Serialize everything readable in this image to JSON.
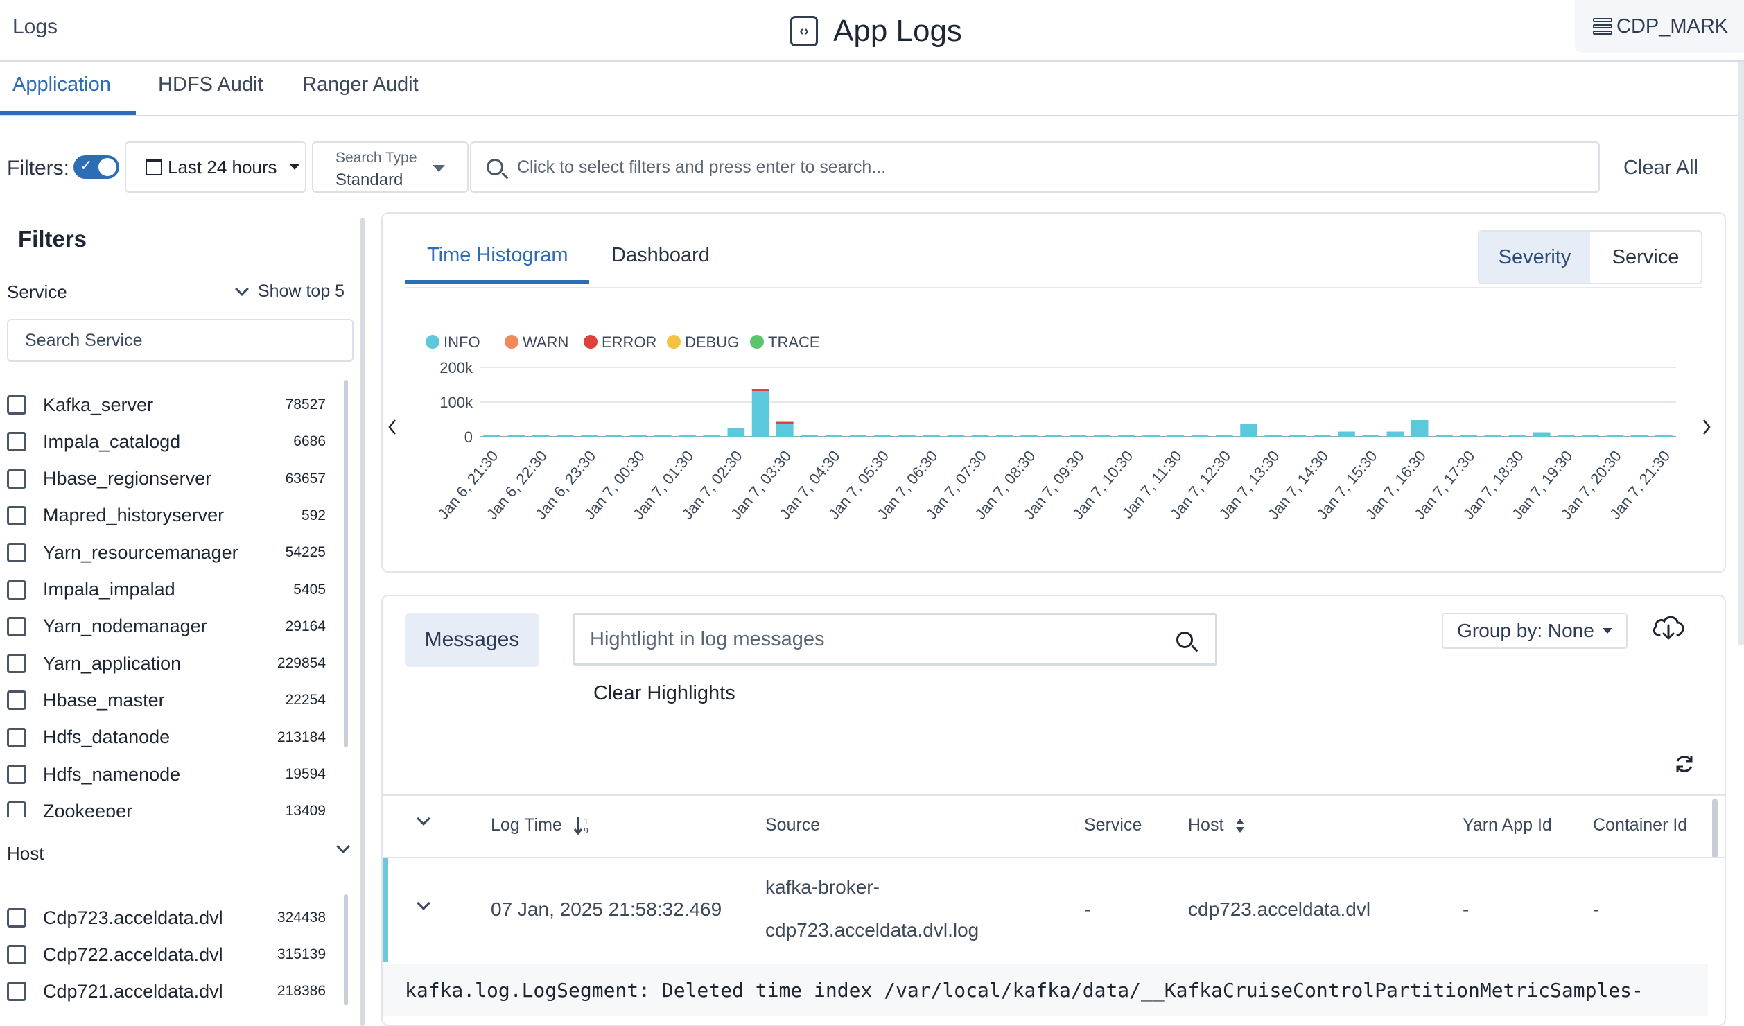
{
  "header": {
    "breadcrumb": "Logs",
    "title": "App Logs",
    "cluster": "CDP_MARK"
  },
  "tabs": [
    {
      "label": "Application",
      "active": true
    },
    {
      "label": "HDFS Audit",
      "active": false
    },
    {
      "label": "Ranger Audit",
      "active": false
    }
  ],
  "filterbar": {
    "label": "Filters:",
    "toggle_on": true,
    "date_range": "Last 24 hours",
    "search_type_label": "Search Type",
    "search_type_value": "Standard",
    "search_placeholder": "Click to select filters and press enter to search...",
    "clear_all": "Clear All"
  },
  "left_filters": {
    "title": "Filters",
    "service_heading": "Service",
    "show_top": "Show top 5",
    "search_placeholder": "Search Service",
    "services": [
      {
        "name": "Kafka_server",
        "count": "78527"
      },
      {
        "name": "Impala_catalogd",
        "count": "6686"
      },
      {
        "name": "Hbase_regionserver",
        "count": "63657"
      },
      {
        "name": "Mapred_historyserver",
        "count": "592"
      },
      {
        "name": "Yarn_resourcemanager",
        "count": "54225"
      },
      {
        "name": "Impala_impalad",
        "count": "5405"
      },
      {
        "name": "Yarn_nodemanager",
        "count": "29164"
      },
      {
        "name": "Yarn_application",
        "count": "229854"
      },
      {
        "name": "Hbase_master",
        "count": "22254"
      },
      {
        "name": "Hdfs_datanode",
        "count": "213184"
      },
      {
        "name": "Hdfs_namenode",
        "count": "19594"
      },
      {
        "name": "Zookeeper",
        "count": "13409"
      }
    ],
    "host_heading": "Host",
    "hosts": [
      {
        "name": "Cdp723.acceldata.dvl",
        "count": "324438"
      },
      {
        "name": "Cdp722.acceldata.dvl",
        "count": "315139"
      },
      {
        "name": "Cdp721.acceldata.dvl",
        "count": "218386"
      }
    ]
  },
  "histogram": {
    "tabs": [
      "Time Histogram",
      "Dashboard"
    ],
    "toggle": [
      "Severity",
      "Service"
    ],
    "toggle_active": "Severity"
  },
  "chart_data": {
    "type": "bar",
    "stacked": true,
    "legend": [
      {
        "name": "INFO",
        "color": "#5bc8dc"
      },
      {
        "name": "WARN",
        "color": "#f08a5d"
      },
      {
        "name": "ERROR",
        "color": "#e0403c"
      },
      {
        "name": "DEBUG",
        "color": "#f5c242"
      },
      {
        "name": "TRACE",
        "color": "#5cc46a"
      }
    ],
    "legend_position": "top-left",
    "y_ticks": [
      "200k",
      "100k",
      "0"
    ],
    "ylim": [
      0,
      200000
    ],
    "grid": true,
    "x_tick_labels": [
      "Jan 6, 21:30",
      "Jan 6, 22:30",
      "Jan 6, 23:30",
      "Jan 7, 00:30",
      "Jan 7, 01:30",
      "Jan 7, 02:30",
      "Jan 7, 03:30",
      "Jan 7, 04:30",
      "Jan 7, 05:30",
      "Jan 7, 06:30",
      "Jan 7, 07:30",
      "Jan 7, 08:30",
      "Jan 7, 09:30",
      "Jan 7, 10:30",
      "Jan 7, 11:30",
      "Jan 7, 12:30",
      "Jan 7, 13:30",
      "Jan 7, 14:30",
      "Jan 7, 15:30",
      "Jan 7, 16:30",
      "Jan 7, 17:30",
      "Jan 7, 18:30",
      "Jan 7, 19:30",
      "Jan 7, 20:30",
      "Jan 7, 21:30"
    ],
    "bars": [
      {
        "slot": 10.5,
        "info": 25000,
        "warn": 0
      },
      {
        "slot": 11.5,
        "info": 132000,
        "warn": 5000
      },
      {
        "slot": 12.5,
        "info": 37000,
        "warn": 4000
      },
      {
        "slot": 31.5,
        "info": 38000,
        "warn": 0
      },
      {
        "slot": 35.5,
        "info": 15000,
        "warn": 0
      },
      {
        "slot": 37.5,
        "info": 15000,
        "warn": 0
      },
      {
        "slot": 38.5,
        "info": 48000,
        "warn": 0
      },
      {
        "slot": 43.5,
        "info": 13000,
        "warn": 0
      }
    ],
    "min_bar_slots": [
      0.5,
      1.5,
      2.5,
      3.5,
      4.5,
      5.5,
      6.5,
      7.5,
      8.5,
      9.5,
      13.5,
      14.5,
      15.5,
      16.5,
      17.5,
      18.5,
      19.5,
      20.5,
      21.5,
      22.5,
      23.5,
      24.5,
      25.5,
      26.5,
      27.5,
      28.5,
      29.5,
      30.5,
      32.5,
      33.5,
      34.5,
      36.5,
      39.5,
      40.5,
      41.5,
      42.5,
      44.5,
      45.5,
      46.5,
      47.5,
      48.5
    ]
  },
  "messages": {
    "button": "Messages",
    "highlight_placeholder": "Hightlight in log messages",
    "clear_highlights": "Clear Highlights",
    "group_by": "Group by: None",
    "columns": [
      "Log Time",
      "Source",
      "Service",
      "Host",
      "Yarn App Id",
      "Container Id"
    ],
    "rows": [
      {
        "log_time": "07 Jan, 2025 21:58:32.469",
        "source_line1": "kafka-broker-",
        "source_line2": "cdp723.acceldata.dvl.log",
        "service": "-",
        "host": "cdp723.acceldata.dvl",
        "yarn_app_id": "-",
        "container_id": "-",
        "message": "kafka.log.LogSegment: Deleted time index /var/local/kafka/data/__KafkaCruiseControlPartitionMetricSamples-"
      }
    ]
  }
}
